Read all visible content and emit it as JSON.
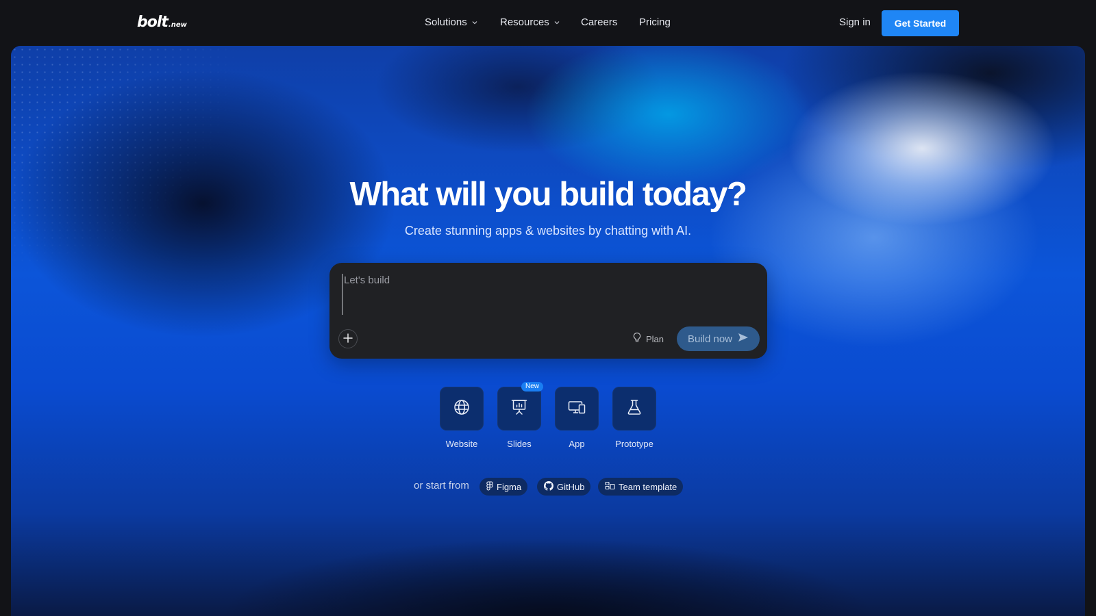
{
  "header": {
    "logo_main": "bolt",
    "logo_suffix": ".new",
    "nav": [
      {
        "label": "Solutions",
        "has_dropdown": true
      },
      {
        "label": "Resources",
        "has_dropdown": true
      },
      {
        "label": "Careers",
        "has_dropdown": false
      },
      {
        "label": "Pricing",
        "has_dropdown": false
      }
    ],
    "sign_in": "Sign in",
    "get_started": "Get Started"
  },
  "hero": {
    "title": "What will you build today?",
    "subtitle": "Create stunning apps & websites by chatting with AI."
  },
  "prompt": {
    "placeholder": "Let's build",
    "value": "",
    "add_icon": "plus-icon",
    "plan_label": "Plan",
    "plan_icon": "lightbulb-icon",
    "build_label": "Build now",
    "build_icon": "send-arrow-icon"
  },
  "modes": [
    {
      "label": "Website",
      "icon": "globe-icon"
    },
    {
      "label": "Slides",
      "icon": "presentation-icon",
      "badge": "New"
    },
    {
      "label": "App",
      "icon": "devices-icon"
    },
    {
      "label": "Prototype",
      "icon": "flask-icon"
    }
  ],
  "start_from": {
    "label": "or start from",
    "options": [
      {
        "label": "Figma",
        "icon": "figma-icon"
      },
      {
        "label": "GitHub",
        "icon": "github-icon"
      },
      {
        "label": "Team template",
        "icon": "team-template-icon"
      }
    ]
  },
  "colors": {
    "page_bg": "#121317",
    "primary_button": "#1f86f5",
    "prompt_bg": "#202124",
    "build_button": "#2e5a8c",
    "tile_bg": "#0c2e6e",
    "badge": "#1a7ef2"
  }
}
